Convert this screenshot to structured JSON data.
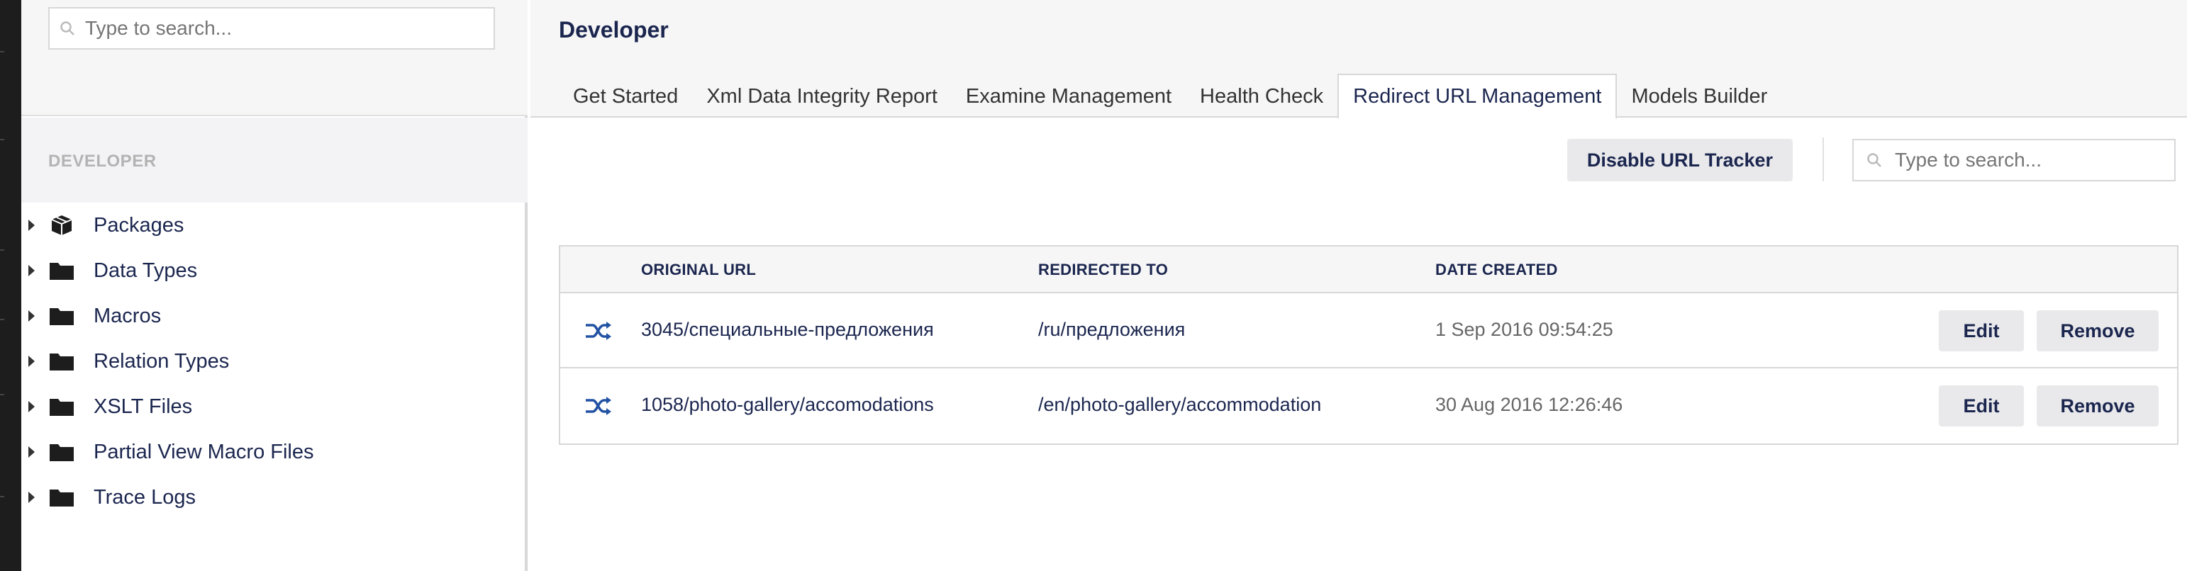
{
  "tree": {
    "search_placeholder": "Type to search...",
    "section_title": "DEVELOPER",
    "items": [
      {
        "label": "Packages",
        "icon": "package-icon"
      },
      {
        "label": "Data Types",
        "icon": "folder-icon"
      },
      {
        "label": "Macros",
        "icon": "folder-icon"
      },
      {
        "label": "Relation Types",
        "icon": "folder-icon"
      },
      {
        "label": "XSLT Files",
        "icon": "folder-icon"
      },
      {
        "label": "Partial View Macro Files",
        "icon": "folder-icon"
      },
      {
        "label": "Trace Logs",
        "icon": "folder-icon"
      }
    ]
  },
  "header": {
    "title": "Developer",
    "tabs": [
      {
        "label": "Get Started",
        "active": false
      },
      {
        "label": "Xml Data Integrity Report",
        "active": false
      },
      {
        "label": "Examine Management",
        "active": false
      },
      {
        "label": "Health Check",
        "active": false
      },
      {
        "label": "Redirect URL Management",
        "active": true
      },
      {
        "label": "Models Builder",
        "active": false
      }
    ]
  },
  "toolbar": {
    "disable_label": "Disable URL Tracker",
    "search_placeholder": "Type to search..."
  },
  "table": {
    "columns": {
      "original_url": "ORIGINAL URL",
      "redirected_to": "REDIRECTED TO",
      "date_created": "DATE CREATED"
    },
    "rows": [
      {
        "original_url": "3045/специальные-предложения",
        "redirected_to": "/ru/предложения",
        "date_created": "1 Sep 2016 09:54:25",
        "edit": "Edit",
        "remove": "Remove"
      },
      {
        "original_url": "1058/photo-gallery/accomodations",
        "redirected_to": "/en/photo-gallery/accommodation",
        "date_created": "30 Aug 2016 12:26:46",
        "edit": "Edit",
        "remove": "Remove"
      }
    ]
  },
  "colors": {
    "accent": "#2152a3",
    "text": "#1b264f",
    "button_bg": "#e9e9eb"
  }
}
